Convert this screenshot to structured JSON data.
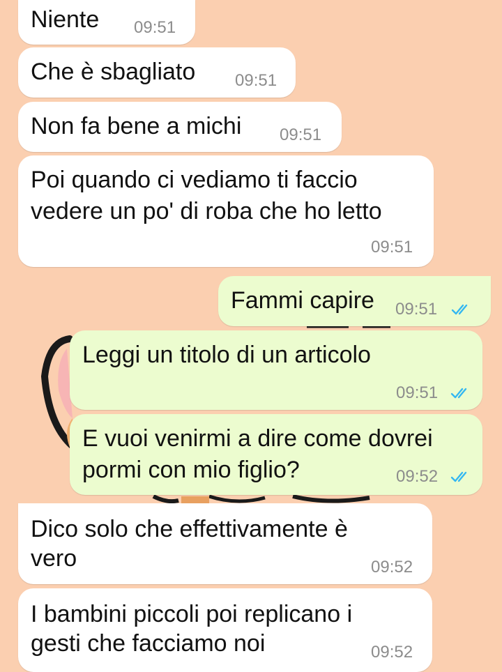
{
  "theme": {
    "background": "#fbcfb0",
    "incoming_bubble": "#ffffff",
    "outgoing_bubble": "#ecfccf",
    "read_tick": "#34b7f1"
  },
  "messages": [
    {
      "direction": "incoming",
      "lines": [
        "Niente"
      ],
      "time": "09:51"
    },
    {
      "direction": "incoming",
      "lines": [
        "Che è sbagliato"
      ],
      "time": "09:51"
    },
    {
      "direction": "incoming",
      "lines": [
        "Non fa bene a michi"
      ],
      "time": "09:51"
    },
    {
      "direction": "incoming",
      "lines": [
        "Poi quando ci vediamo ti faccio",
        "vedere un po' di roba che ho letto"
      ],
      "time": "09:51"
    },
    {
      "direction": "outgoing",
      "lines": [
        "Fammi capire"
      ],
      "time": "09:51",
      "status": "read-double-check-icon"
    },
    {
      "direction": "outgoing",
      "lines": [
        "Leggi un titolo di un articolo"
      ],
      "time": "09:51",
      "status": "read-double-check-icon"
    },
    {
      "direction": "outgoing",
      "lines": [
        "E vuoi venirmi a dire come dovrei",
        "pormi con mio figlio?"
      ],
      "time": "09:52",
      "status": "read-double-check-icon"
    },
    {
      "direction": "incoming",
      "lines": [
        "Dico solo che effettivamente è",
        "vero"
      ],
      "time": "09:52"
    },
    {
      "direction": "incoming",
      "lines": [
        "I bambini piccoli poi replicano i",
        "gesti che facciamo noi"
      ],
      "time": "09:52"
    }
  ]
}
